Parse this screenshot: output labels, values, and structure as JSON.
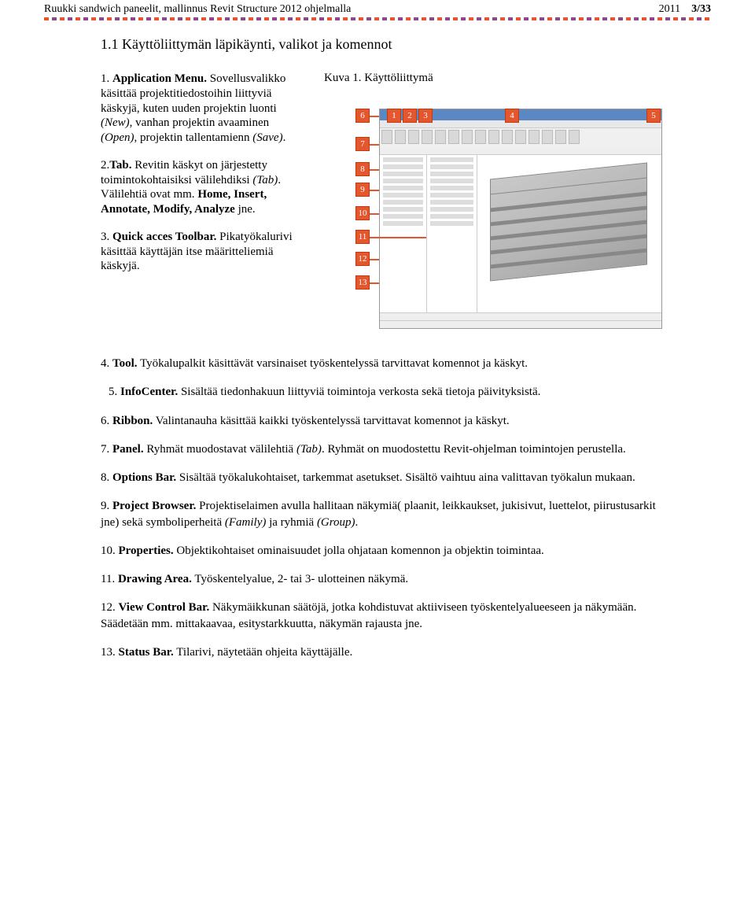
{
  "header": {
    "left": "Ruukki sandwich paneelit, mallinnus Revit Structure 2012 ohjelmalla",
    "year": "2011",
    "page": "3/33"
  },
  "section_title": "1.1 Käyttöliittymän läpikäynti, valikot ja komennot",
  "left": {
    "p1a": "1. ",
    "p1b": "Application Menu.",
    "p1c": " Sovellusvalikko käsittää projektitiedostoihin liittyviä käskyjä, kuten uuden projektin luonti ",
    "p1d": "(New)",
    "p1e": ", vanhan projektin avaaminen ",
    "p1f": "(Open)",
    "p1g": ", projektin tallentamienn ",
    "p1h": "(Save)",
    "p1i": ".",
    "p2a": "2.",
    "p2b": "Tab.",
    "p2c": " Revitin käskyt on järjestetty toimintokohtaisiksi välilehdiksi ",
    "p2d": "(Tab)",
    "p2e": ". Välilehtiä ovat mm. ",
    "p2f": "Home, Insert, Annotate, Modify, Analyze",
    "p2g": " jne.",
    "p3a": "3. ",
    "p3b": "Quick acces Toolbar.",
    "p3c": " Pikatyökalurivi käsittää käyttäjän itse määritteliemiä käskyjä."
  },
  "figure_caption": "Kuva 1. Käyttöliittymä",
  "callouts": {
    "c1": "1",
    "c2": "2",
    "c3": "3",
    "c4": "4",
    "c5": "5",
    "c6": "6",
    "c7": "7",
    "c8": "8",
    "c9": "9",
    "c10": "10",
    "c11": "11",
    "c12": "12",
    "c13": "13"
  },
  "body": {
    "p4a": "4. ",
    "p4b": "Tool.",
    "p4c": " Työkalupalkit käsittävät varsinaiset työskentelyssä tarvittavat komennot ja käskyt.",
    "p5a": "5. ",
    "p5b": "InfoCenter.",
    "p5c": " Sisältää tiedonhakuun liittyviä toimintoja verkosta sekä tietoja päivityksistä.",
    "p6a": "6. ",
    "p6b": "Ribbon.",
    "p6c": " Valintanauha käsittää kaikki työskentelyssä tarvittavat komennot ja käskyt.",
    "p7a": "7. ",
    "p7b": "Panel.",
    "p7c": " Ryhmät muodostavat välilehtiä ",
    "p7d": "(Tab)",
    "p7e": ". Ryhmät on muodostettu Revit-ohjelman toimintojen perustella.",
    "p8a": "8. ",
    "p8b": "Options Bar.",
    "p8c": " Sisältää työkalukohtaiset, tarkemmat asetukset. Sisältö vaihtuu aina valittavan työkalun mukaan.",
    "p9a": "9. ",
    "p9b": "Project Browser.",
    "p9c": " Projektiselaimen avulla hallitaan näkymiä( plaanit, leikkaukset, jukisivut, luettelot, piirustusarkit jne) sekä symboliperheitä ",
    "p9d": "(Family)",
    "p9e": " ja ryhmiä ",
    "p9f": "(Group)",
    "p9g": ".",
    "p10a": "10. ",
    "p10b": "Properties.",
    "p10c": " Objektikohtaiset ominaisuudet jolla ohjataan komennon ja objektin toimintaa.",
    "p11a": "11. ",
    "p11b": "Drawing Area.",
    "p11c": " Työskentelyalue, 2- tai 3- ulotteinen näkymä.",
    "p12a": "12. ",
    "p12b": "View Control Bar.",
    "p12c": " Näkymäikkunan säätöjä, jotka kohdistuvat aktiiviseen työskentelyalueeseen ja näkymään. Säädetään mm. mittakaavaa, esitystarkkuutta, näkymän rajausta jne.",
    "p13a": "13. ",
    "p13b": "Status Bar.",
    "p13c": " Tilarivi, näytetään ohjeita käyttäjälle."
  }
}
